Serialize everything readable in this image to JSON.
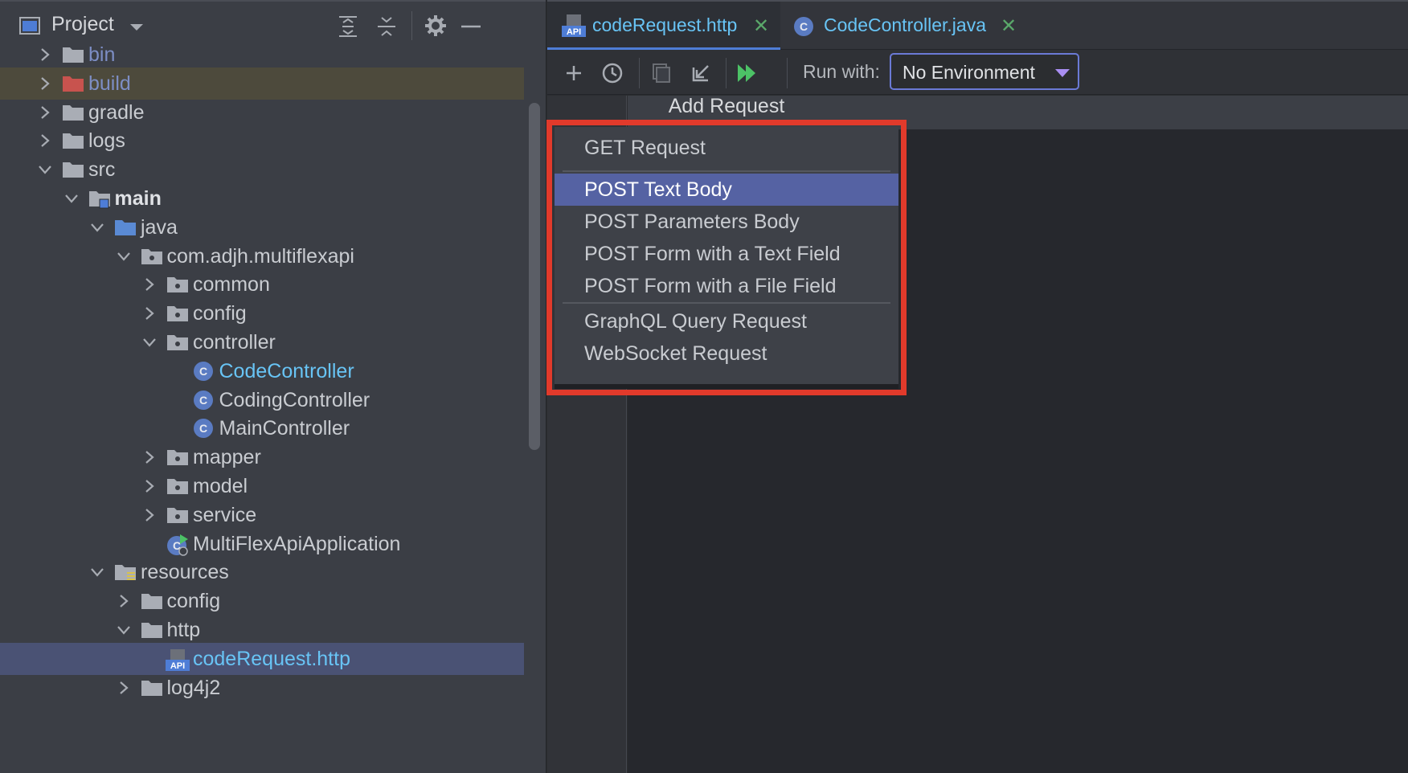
{
  "project_panel": {
    "title": "Project",
    "tree": [
      {
        "label": "bin",
        "indent": 0,
        "expanded": false,
        "icon": "folder-icon",
        "style": "blue"
      },
      {
        "label": "build",
        "indent": 0,
        "expanded": false,
        "icon": "folder-excluded-icon",
        "style": "red"
      },
      {
        "label": "gradle",
        "indent": 0,
        "expanded": false,
        "icon": "folder-icon",
        "style": "normal"
      },
      {
        "label": "logs",
        "indent": 0,
        "expanded": false,
        "icon": "folder-icon",
        "style": "normal"
      },
      {
        "label": "src",
        "indent": 0,
        "expanded": true,
        "icon": "folder-icon",
        "style": "normal"
      },
      {
        "label": "main",
        "indent": 1,
        "expanded": true,
        "icon": "module-folder-icon",
        "style": "bold"
      },
      {
        "label": "java",
        "indent": 2,
        "expanded": true,
        "icon": "source-folder-icon",
        "style": "normal"
      },
      {
        "label": "com.adjh.multiflexapi",
        "indent": 3,
        "expanded": true,
        "icon": "package-icon",
        "style": "normal"
      },
      {
        "label": "common",
        "indent": 4,
        "expanded": false,
        "icon": "package-icon",
        "style": "normal"
      },
      {
        "label": "config",
        "indent": 4,
        "expanded": false,
        "icon": "package-icon",
        "style": "normal"
      },
      {
        "label": "controller",
        "indent": 4,
        "expanded": true,
        "icon": "package-icon",
        "style": "normal"
      },
      {
        "label": "CodeController",
        "indent": 5,
        "expanded": null,
        "icon": "java-class-icon",
        "style": "cyan"
      },
      {
        "label": "CodingController",
        "indent": 5,
        "expanded": null,
        "icon": "java-class-icon",
        "style": "normal"
      },
      {
        "label": "MainController",
        "indent": 5,
        "expanded": null,
        "icon": "java-class-icon",
        "style": "normal"
      },
      {
        "label": "mapper",
        "indent": 4,
        "expanded": false,
        "icon": "package-icon",
        "style": "normal"
      },
      {
        "label": "model",
        "indent": 4,
        "expanded": false,
        "icon": "package-icon",
        "style": "normal"
      },
      {
        "label": "service",
        "indent": 4,
        "expanded": false,
        "icon": "package-icon",
        "style": "normal"
      },
      {
        "label": "MultiFlexApiApplication",
        "indent": 4,
        "expanded": null,
        "icon": "spring-app-icon",
        "style": "normal"
      },
      {
        "label": "resources",
        "indent": 2,
        "expanded": true,
        "icon": "resources-folder-icon",
        "style": "normal"
      },
      {
        "label": "config",
        "indent": 3,
        "expanded": false,
        "icon": "folder-icon",
        "style": "normal"
      },
      {
        "label": "http",
        "indent": 3,
        "expanded": true,
        "icon": "folder-icon",
        "style": "normal"
      },
      {
        "label": "codeRequest.http",
        "indent": 4,
        "expanded": null,
        "icon": "api-file-icon",
        "style": "cyan",
        "selected": true
      },
      {
        "label": "log4j2",
        "indent": 3,
        "expanded": false,
        "icon": "folder-icon",
        "style": "normal"
      }
    ]
  },
  "tabs": [
    {
      "label": "codeRequest.http",
      "icon": "api-file-icon",
      "active": true
    },
    {
      "label": "CodeController.java",
      "icon": "java-class-icon",
      "active": false
    }
  ],
  "toolbar": {
    "run_with_label": "Run with:",
    "environment": "No Environment"
  },
  "popup": {
    "title": "Add Request",
    "items": [
      {
        "label": "GET Request",
        "group": 0,
        "highlighted": false
      },
      {
        "label": "POST Text Body",
        "group": 1,
        "highlighted": true
      },
      {
        "label": "POST Parameters Body",
        "group": 1,
        "highlighted": false
      },
      {
        "label": "POST Form with a Text Field",
        "group": 1,
        "highlighted": false
      },
      {
        "label": "POST Form with a File Field",
        "group": 1,
        "highlighted": false
      },
      {
        "label": "GraphQL Query Request",
        "group": 2,
        "highlighted": false
      },
      {
        "label": "WebSocket Request",
        "group": 2,
        "highlighted": false
      }
    ]
  },
  "colors": {
    "accent": "#5562a3",
    "highlight_frame": "#e13a2b",
    "run_green": "#4cc266"
  }
}
